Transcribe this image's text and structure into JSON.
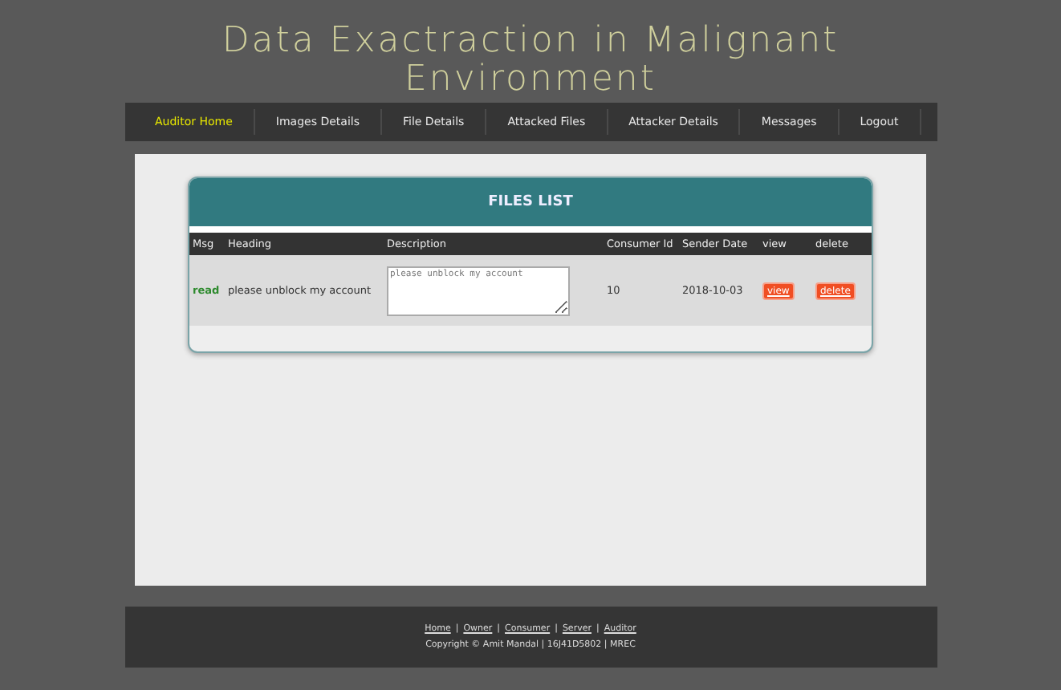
{
  "site_title": "Data Exactraction in Malignant Environment",
  "nav": [
    {
      "label": "Auditor Home",
      "selected": true
    },
    {
      "label": "Images Details",
      "selected": false
    },
    {
      "label": "File Details",
      "selected": false
    },
    {
      "label": "Attacked Files",
      "selected": false
    },
    {
      "label": "Attacker Details",
      "selected": false
    },
    {
      "label": "Messages",
      "selected": false
    },
    {
      "label": "Logout",
      "selected": false
    }
  ],
  "files_list": {
    "title": "FILES LIST",
    "columns": [
      "Msg",
      "Heading",
      "Description",
      "Consumer Id",
      "Sender Date",
      "view",
      "delete"
    ],
    "rows": [
      {
        "msg": "read",
        "heading": "please unblock my account",
        "description": "please unblock my account",
        "consumer_id": "10",
        "sender_date": "2018-10-03",
        "view": "view",
        "delete": "delete"
      }
    ]
  },
  "footer": {
    "separator": "|",
    "links": [
      "Home",
      "Owner",
      "Consumer",
      "Server",
      "Auditor"
    ],
    "copyright": "Copyright © Amit Mandal | 16J41D5802 | MREC"
  }
}
